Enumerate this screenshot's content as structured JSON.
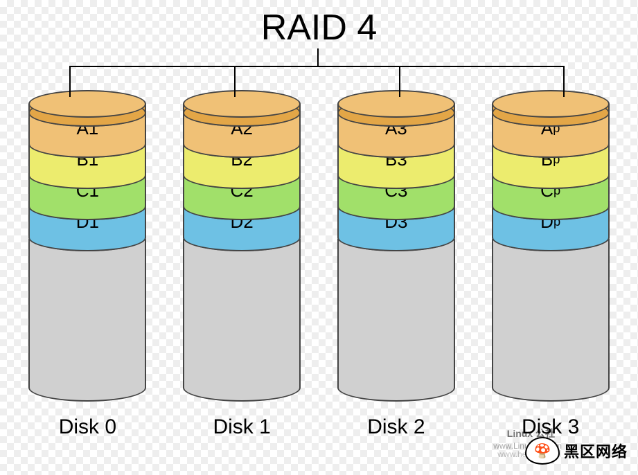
{
  "title": "RAID 4",
  "colors": {
    "top": {
      "side": "#e3a647",
      "cap": "#f0c176"
    },
    "orange": {
      "side": "#f0c176",
      "cap": "#f6d79b"
    },
    "yellow": {
      "side": "#ecec6e",
      "cap": "#f4f49a"
    },
    "green": {
      "side": "#a1e06a",
      "cap": "#c0ee96"
    },
    "blue": {
      "side": "#6ec1e4",
      "cap": "#9fd6ee"
    },
    "grey": {
      "side": "#d0d0d0",
      "cap": "#e0e0e0"
    }
  },
  "disks": [
    {
      "label": "Disk 0",
      "stripes": [
        "A1",
        "B1",
        "C1",
        "D1"
      ]
    },
    {
      "label": "Disk 1",
      "stripes": [
        "A2",
        "B2",
        "C2",
        "D2"
      ]
    },
    {
      "label": "Disk 2",
      "stripes": [
        "A3",
        "B3",
        "C3",
        "D3"
      ]
    },
    {
      "label": "Disk 3",
      "stripes": [
        "Ap",
        "Bp",
        "Cp",
        "Dp"
      ],
      "parity": true
    }
  ],
  "watermark1": "www.Linuxidc.com",
  "watermark2": "www.hei区.com",
  "logo_text": "黑区网络",
  "logo_sub": "Linux 公社"
}
